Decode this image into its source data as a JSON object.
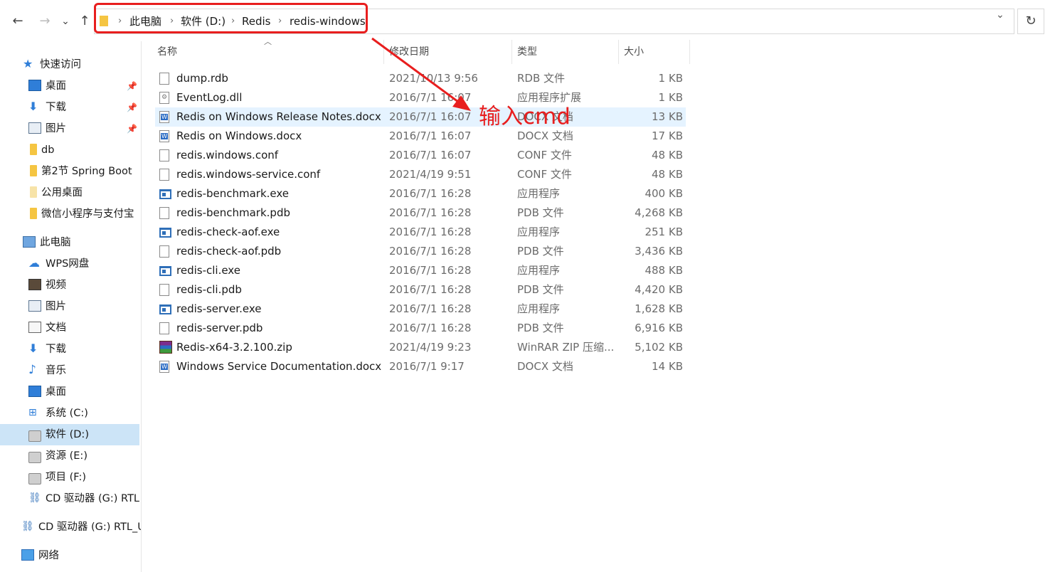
{
  "toolbar": {
    "back_icon": "←",
    "forward_icon": "→",
    "recent_icon": "⌄",
    "up_icon": "↑",
    "refresh_icon": "↻",
    "dropdown_icon": "⌄"
  },
  "breadcrumb": {
    "items": [
      "此电脑",
      "软件 (D:)",
      "Redis",
      "redis-windows"
    ],
    "separator": "›"
  },
  "sidebar": {
    "quick_access": "快速访问",
    "pinned": [
      {
        "label": "桌面",
        "icon": "desktop-icon",
        "pinned": true
      },
      {
        "label": "下载",
        "icon": "download-icon",
        "pinned": true
      },
      {
        "label": "图片",
        "icon": "pictures-icon",
        "pinned": true
      },
      {
        "label": "db",
        "icon": "folder-icon",
        "pinned": false
      },
      {
        "label": "第2节 Spring Boot",
        "icon": "folder-icon",
        "pinned": false
      },
      {
        "label": "公用桌面",
        "icon": "folder-icon",
        "pinned": false
      },
      {
        "label": "微信小程序与支付宝",
        "icon": "folder-icon",
        "pinned": false
      }
    ],
    "this_pc": "此电脑",
    "pc_items": [
      {
        "label": "WPS网盘",
        "icon": "cloud-icon"
      },
      {
        "label": "视频",
        "icon": "video-icon"
      },
      {
        "label": "图片",
        "icon": "pictures-icon"
      },
      {
        "label": "文档",
        "icon": "document-icon"
      },
      {
        "label": "下载",
        "icon": "download-icon"
      },
      {
        "label": "音乐",
        "icon": "music-icon"
      },
      {
        "label": "桌面",
        "icon": "desktop-icon"
      },
      {
        "label": "系统 (C:)",
        "icon": "windows-drive-icon"
      },
      {
        "label": "软件 (D:)",
        "icon": "drive-icon",
        "selected": true
      },
      {
        "label": "资源 (E:)",
        "icon": "drive-icon"
      },
      {
        "label": "项目 (F:)",
        "icon": "drive-icon"
      },
      {
        "label": "CD 驱动器 (G:) RTL",
        "icon": "cd-drive-icon"
      }
    ],
    "cd_root": "CD 驱动器 (G:) RTL_U",
    "network": "网络"
  },
  "columns": {
    "name": "名称",
    "date": "修改日期",
    "type": "类型",
    "size": "大小"
  },
  "files": [
    {
      "name": "dump.rdb",
      "date": "2021/10/13 9:56",
      "type": "RDB 文件",
      "size": "1 KB",
      "icon": "file"
    },
    {
      "name": "EventLog.dll",
      "date": "2016/7/1 16:07",
      "type": "应用程序扩展",
      "size": "1 KB",
      "icon": "dll"
    },
    {
      "name": "Redis on Windows Release Notes.docx",
      "date": "2016/7/1 16:07",
      "type": "DOCX 文档",
      "size": "13 KB",
      "icon": "word",
      "highlighted": true
    },
    {
      "name": "Redis on Windows.docx",
      "date": "2016/7/1 16:07",
      "type": "DOCX 文档",
      "size": "17 KB",
      "icon": "word"
    },
    {
      "name": "redis.windows.conf",
      "date": "2016/7/1 16:07",
      "type": "CONF 文件",
      "size": "48 KB",
      "icon": "file"
    },
    {
      "name": "redis.windows-service.conf",
      "date": "2021/4/19 9:51",
      "type": "CONF 文件",
      "size": "48 KB",
      "icon": "file"
    },
    {
      "name": "redis-benchmark.exe",
      "date": "2016/7/1 16:28",
      "type": "应用程序",
      "size": "400 KB",
      "icon": "exe"
    },
    {
      "name": "redis-benchmark.pdb",
      "date": "2016/7/1 16:28",
      "type": "PDB 文件",
      "size": "4,268 KB",
      "icon": "file"
    },
    {
      "name": "redis-check-aof.exe",
      "date": "2016/7/1 16:28",
      "type": "应用程序",
      "size": "251 KB",
      "icon": "exe"
    },
    {
      "name": "redis-check-aof.pdb",
      "date": "2016/7/1 16:28",
      "type": "PDB 文件",
      "size": "3,436 KB",
      "icon": "file"
    },
    {
      "name": "redis-cli.exe",
      "date": "2016/7/1 16:28",
      "type": "应用程序",
      "size": "488 KB",
      "icon": "exe"
    },
    {
      "name": "redis-cli.pdb",
      "date": "2016/7/1 16:28",
      "type": "PDB 文件",
      "size": "4,420 KB",
      "icon": "file"
    },
    {
      "name": "redis-server.exe",
      "date": "2016/7/1 16:28",
      "type": "应用程序",
      "size": "1,628 KB",
      "icon": "exe"
    },
    {
      "name": "redis-server.pdb",
      "date": "2016/7/1 16:28",
      "type": "PDB 文件",
      "size": "6,916 KB",
      "icon": "file"
    },
    {
      "name": "Redis-x64-3.2.100.zip",
      "date": "2021/4/19 9:23",
      "type": "WinRAR ZIP 压缩...",
      "size": "5,102 KB",
      "icon": "zip"
    },
    {
      "name": "Windows Service Documentation.docx",
      "date": "2016/7/1 9:17",
      "type": "DOCX 文档",
      "size": "14 KB",
      "icon": "word"
    }
  ],
  "annotation": {
    "text": "输入cmd",
    "color": "#e81e1e"
  }
}
